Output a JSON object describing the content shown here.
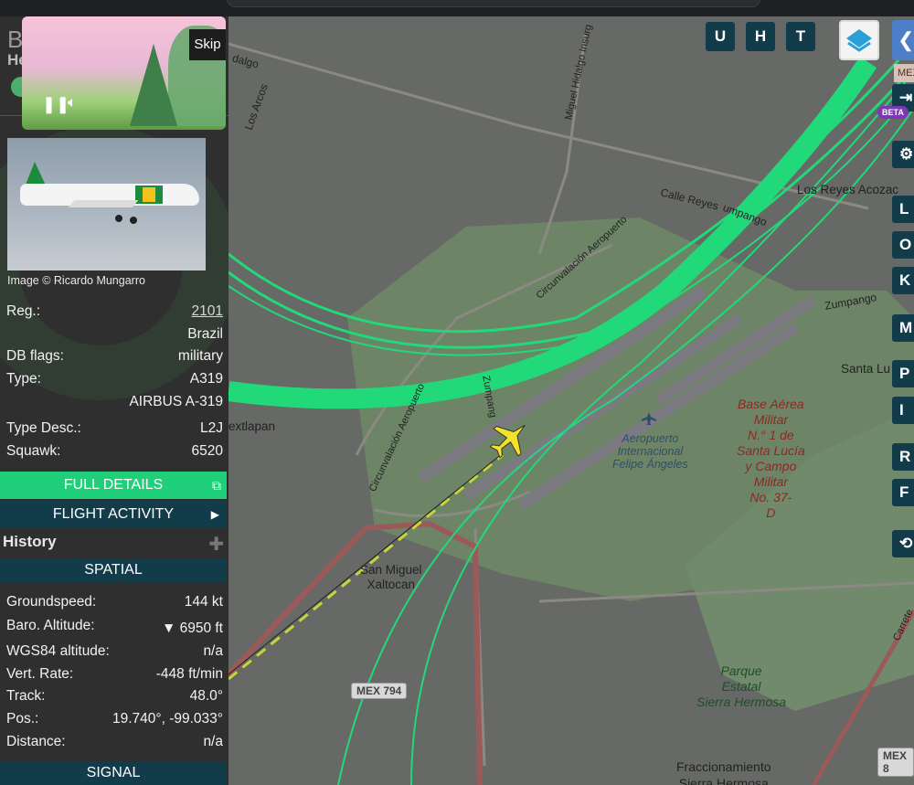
{
  "video": {
    "skip_label": "Skip"
  },
  "aircraft_header": {
    "callsign_fragment": "B",
    "name_fragment": "He"
  },
  "photo": {
    "credit": "Image © Ricardo Mungarro"
  },
  "details": {
    "reg_label": "Reg.:",
    "reg_value": "2101",
    "country": "Brazil",
    "dbflags_label": "DB flags:",
    "dbflags_value": "military",
    "type_label": "Type:",
    "type_value": "A319",
    "type_full": "AIRBUS A-319",
    "typedesc_label": "Type Desc.:",
    "typedesc_value": "L2J",
    "squawk_label": "Squawk:",
    "squawk_value": "6520"
  },
  "buttons": {
    "full_details": "FULL DETAILS",
    "flight_activity": "FLIGHT ACTIVITY"
  },
  "history": {
    "label": "History"
  },
  "spatial": {
    "header": "SPATIAL",
    "groundspeed_label": "Groundspeed:",
    "groundspeed_value": "144 kt",
    "baro_label": "Baro. Altitude:",
    "baro_value": "▼ 6950 ft",
    "wgs_label": "WGS84 altitude:",
    "wgs_value": "n/a",
    "vrate_label": "Vert. Rate:",
    "vrate_value": "-448 ft/min",
    "track_label": "Track:",
    "track_value": "48.0°",
    "pos_label": "Pos.:",
    "pos_value": "19.740°, -99.033°",
    "distance_label": "Distance:",
    "distance_value": "n/a"
  },
  "signal": {
    "header": "SIGNAL"
  },
  "map_controls": {
    "u": "U",
    "h": "H",
    "t": "T",
    "right_buttons": [
      "L",
      "O",
      "K",
      "M",
      "P",
      "I",
      "R",
      "F"
    ],
    "beta": "BETA"
  },
  "map_labels": {
    "dalgo": "dalgo",
    "los_arcos": "Los Arcos",
    "miguel_hidalgo": "Miguel Hidalgo Insurg",
    "calle_reyes": "Calle Reyes",
    "jumpango": "umpango",
    "los_reyes": "Los Reyes Acozac",
    "circ1": "Circunvalación Aeropuerto",
    "circ2": "Circunvalación Aeropuerto",
    "zumpango": "Zumpango",
    "zumpango2": "Zumpang",
    "santa_lu": "Santa Lu",
    "nextlapan": "extlapan",
    "base_aerea": "Base Aérea\nMilitar\nN.° 1 de\nSanta Lucía\ny Campo\nMilitar\nNo. 37-\nD",
    "aeropuerto": "Aeropuerto\nInternacional\nFelipe Ángeles",
    "san_miguel": "San Miguel\nXaltocan",
    "mex794": "MEX 794",
    "parque": "Parque\nEstatal\nSierra Hermosa",
    "fraccionamiento": "Fraccionamiento\nSierra Hermosa",
    "carretera": "Carrete",
    "mex_b": "MEX 8",
    "mex_top": "MEX"
  }
}
